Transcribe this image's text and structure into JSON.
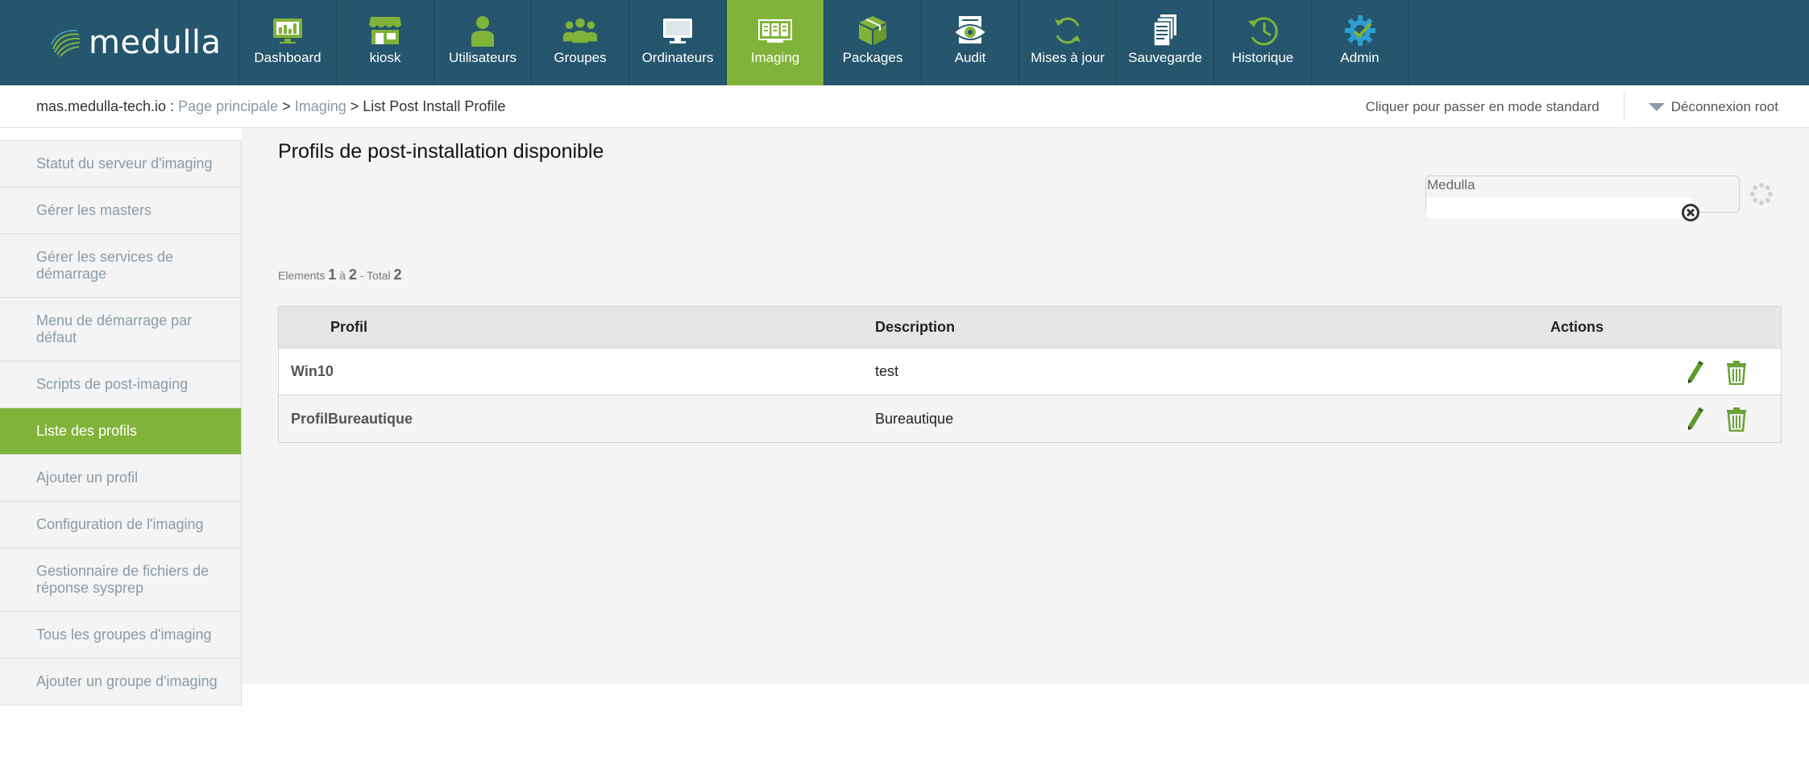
{
  "app": {
    "logo_text": "medulla"
  },
  "nav": {
    "items": [
      {
        "label": "Dashboard",
        "icon": "dashboard-icon"
      },
      {
        "label": "kiosk",
        "icon": "kiosk-icon"
      },
      {
        "label": "Utilisateurs",
        "icon": "user-icon"
      },
      {
        "label": "Groupes",
        "icon": "group-icon"
      },
      {
        "label": "Ordinateurs",
        "icon": "monitor-icon"
      },
      {
        "label": "Imaging",
        "icon": "imaging-icon",
        "active": true
      },
      {
        "label": "Packages",
        "icon": "package-icon"
      },
      {
        "label": "Audit",
        "icon": "audit-icon"
      },
      {
        "label": "Mises à jour",
        "icon": "refresh-icon"
      },
      {
        "label": "Sauvegarde",
        "icon": "backup-icon"
      },
      {
        "label": "Historique",
        "icon": "history-icon"
      },
      {
        "label": "Admin",
        "icon": "admin-gear-icon"
      }
    ],
    "colors": {
      "bar": "#25566e",
      "active": "#80b339",
      "icon_green": "#80b339"
    }
  },
  "breadcrumb": {
    "host": "mas.medulla-tech.io",
    "sep1": " : ",
    "home": "Page principale",
    "sep2": " > ",
    "section": "Imaging",
    "sep3": " > ",
    "current": "List Post Install Profile"
  },
  "header_links": {
    "mode": "Cliquer pour passer en mode standard",
    "logout": "Déconnexion root"
  },
  "sidebar": {
    "items": [
      {
        "label": "Statut du serveur d'imaging"
      },
      {
        "label": "Gérer les masters"
      },
      {
        "label": "Gérer les services de démarrage"
      },
      {
        "label": "Menu de démarrage par défaut"
      },
      {
        "label": "Scripts de post-imaging"
      },
      {
        "label": "Liste des profils",
        "active": true
      },
      {
        "label": "Ajouter un profil"
      },
      {
        "label": "Configuration de l'imaging"
      },
      {
        "label": "Gestionnaire de fichiers de réponse sysprep"
      },
      {
        "label": "Tous les groupes d'imaging"
      },
      {
        "label": "Ajouter un groupe d'imaging"
      }
    ]
  },
  "main": {
    "title": "Profils de post-installation disponible",
    "search": {
      "label": "Medulla",
      "value": ""
    },
    "count": {
      "prefix": "Elements",
      "from": "1",
      "to_word": "à",
      "to": "2",
      "total_word": "- Total",
      "total": "2"
    },
    "table": {
      "headers": [
        "Profil",
        "Description",
        "Actions"
      ],
      "rows": [
        {
          "profil": "Win10",
          "description": "test"
        },
        {
          "profil": "ProfilBureautique",
          "description": "Bureautique"
        }
      ]
    }
  }
}
